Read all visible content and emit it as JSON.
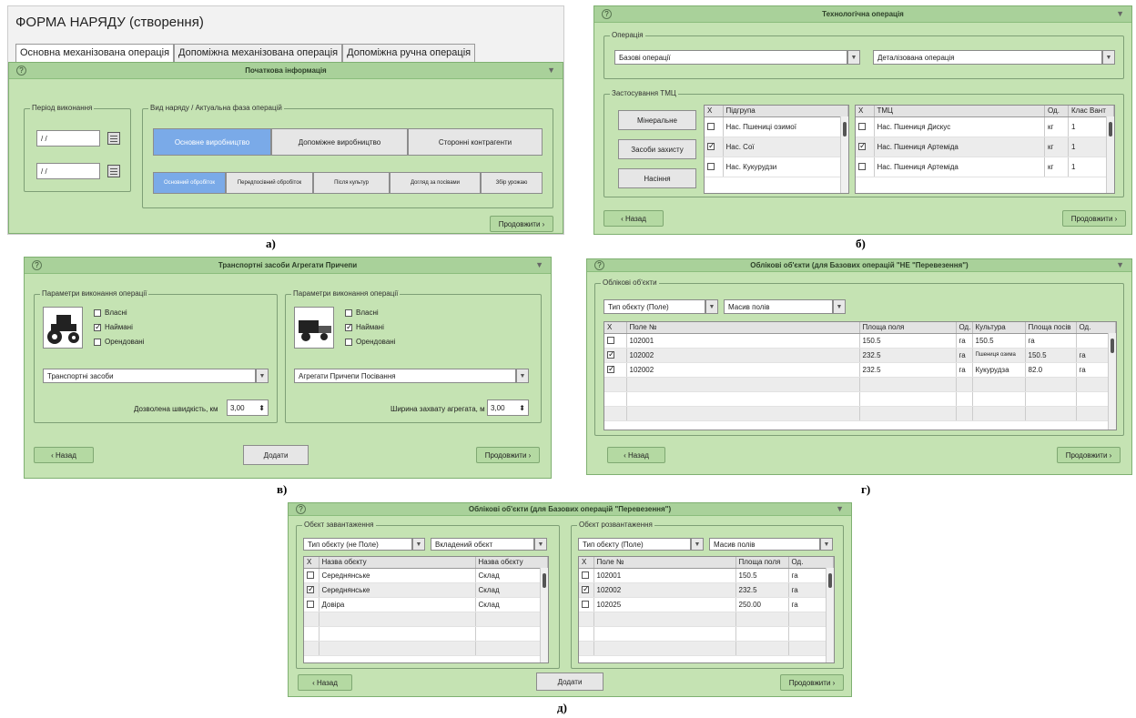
{
  "a": {
    "title": "ФОРМА НАРЯДУ (створення)",
    "tabs": [
      "Основна механізована операція",
      "Допоміжна механізована операція",
      "Допоміжна ручна операція"
    ],
    "header": "Початкова інформація",
    "period_legend": "Період виконання",
    "date1": "/ /",
    "date2": "/ /",
    "type_legend": "Вид наряду / Актуальна фаза операцій",
    "types": [
      "Основне виробництво",
      "Допоміжне виробництво",
      "Сторонні контрагенти"
    ],
    "phases": [
      "Основний обробіток",
      "Передпосівний обробіток",
      "Після культур",
      "Догляд за посівами",
      "Збір урожаю"
    ],
    "next": "Продовжити ›",
    "caption": "а)"
  },
  "b": {
    "header": "Технологічна операція",
    "op_legend": "Операція",
    "op_select": "Базові операції",
    "detail_select": "Деталізована операція",
    "tmc_legend": "Застосування ТМЦ",
    "side_buttons": [
      "Мінеральне",
      "Засоби захисту",
      "Насіння"
    ],
    "t1_headers": [
      "Х",
      "Підгрупа"
    ],
    "t1_rows": [
      {
        "name": "Нас. Пшениці озимої",
        "checked": false
      },
      {
        "name": "Нас. Сої",
        "checked": true
      },
      {
        "name": "Нас. Кукурудзи",
        "checked": false
      }
    ],
    "t2_headers": [
      "Х",
      "ТМЦ",
      "Од.",
      "Клас Вант"
    ],
    "t2_rows": [
      {
        "name": "Нас. Пшениця Дискус",
        "unit": "кг",
        "cls": "1",
        "checked": false
      },
      {
        "name": "Нас. Пшениця Артеміда",
        "unit": "кг",
        "cls": "1",
        "checked": true
      },
      {
        "name": "Нас. Пшениця Артеміда",
        "unit": "кг",
        "cls": "1",
        "checked": false
      }
    ],
    "back": "‹ Назад",
    "next": "Продовжити ›",
    "caption": "б)"
  },
  "v": {
    "header": "Транспортні засоби Агрегати Причепи",
    "legend": "Параметри виконання операції",
    "checks": [
      "Власні",
      "Наймані",
      "Орендовані"
    ],
    "checked": [
      false,
      true,
      false
    ],
    "select1": "Транспортні засоби",
    "select2": "Агрегати Причепи Посівання",
    "speed_label": "Дозволена швидкість, км",
    "speed_value": "3,00",
    "width_label": "Ширина захвату агрегата, м",
    "width_value": "3,00",
    "back": "‹ Назад",
    "add": "Додати",
    "next": "Продовжити ›",
    "caption": "в)"
  },
  "g": {
    "header": "Облікові об'єкти (для Базових операцій \"НЕ \"Перевезення\")",
    "legend": "Облікові об'єкти",
    "select1": "Тип обєкту (Поле)",
    "select2": "Масив полів",
    "headers": [
      "Х",
      "Поле №",
      "Площа поля",
      "Од.",
      "Культура",
      "Площа посів",
      "Од."
    ],
    "rows": [
      {
        "checked": false,
        "field": "102001",
        "area": "150.5",
        "unit": "га",
        "crop": "150.5",
        "sown": "га",
        "unit2": ""
      },
      {
        "checked": true,
        "field": "102002",
        "area": "232.5",
        "unit": "га",
        "crop": "Пшениця озима",
        "sown": "150.5",
        "unit2": "га"
      },
      {
        "checked": true,
        "field": "102002",
        "area": "232.5",
        "unit": "га",
        "crop": "Кукурудза",
        "sown": "82.0",
        "unit2": "га"
      }
    ],
    "back": "‹ Назад",
    "next": "Продовжити ›",
    "caption": "г)"
  },
  "d": {
    "header": "Облікові об'єкти (для Базових операцій \"Перевезення\")",
    "load_legend": "Обєкт завантаження",
    "unload_legend": "Обєкт розвантаження",
    "l_select1": "Тип обєкту (не Поле)",
    "l_select2": "Вкладений обєкт",
    "r_select1": "Тип обєкту (Поле)",
    "r_select2": "Масив полів",
    "l_headers": [
      "Х",
      "Назва обєкту",
      "Назва обєкту"
    ],
    "l_rows": [
      {
        "checked": false,
        "name": "Середнянське",
        "type": "Склад"
      },
      {
        "checked": true,
        "name": "Середнянське",
        "type": "Склад"
      },
      {
        "checked": false,
        "name": "Довіра",
        "type": "Склад"
      }
    ],
    "r_headers": [
      "Х",
      "Поле №",
      "Площа поля",
      "Од."
    ],
    "r_rows": [
      {
        "checked": false,
        "field": "102001",
        "area": "150.5",
        "unit": "га"
      },
      {
        "checked": true,
        "field": "102002",
        "area": "232.5",
        "unit": "га"
      },
      {
        "checked": false,
        "field": "102025",
        "area": "250.00",
        "unit": "га"
      }
    ],
    "back": "‹ Назад",
    "add": "Додати",
    "next": "Продовжити ›",
    "caption": "д)"
  }
}
